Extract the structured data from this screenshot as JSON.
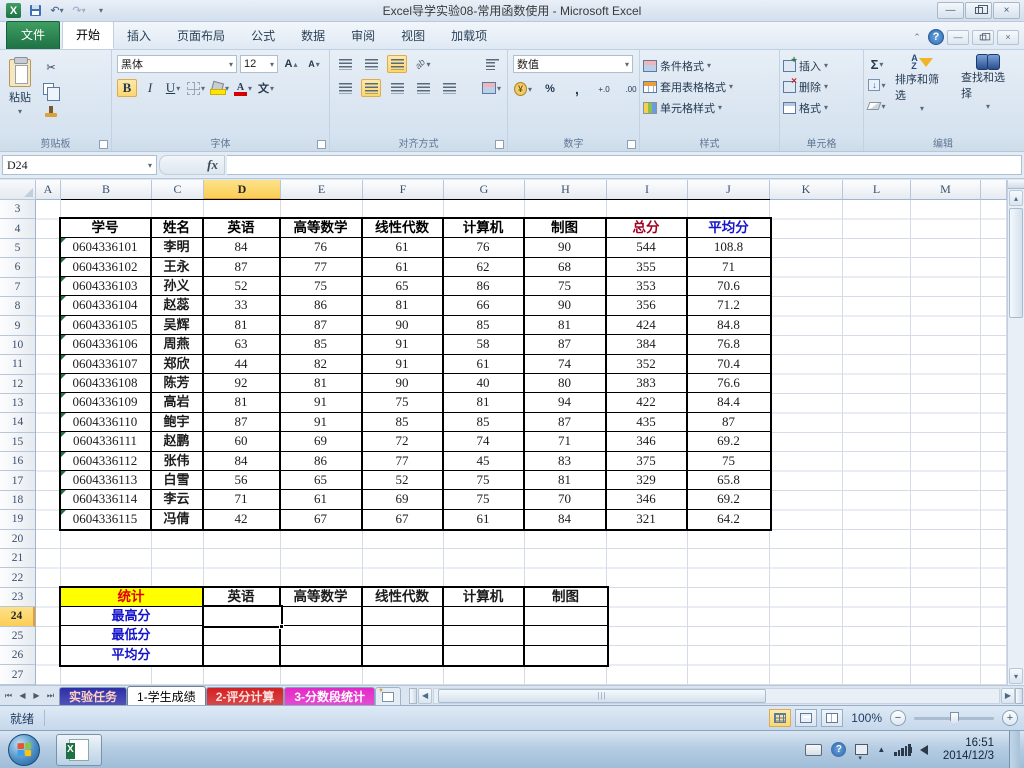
{
  "icons": {
    "dd": "▾",
    "up": "▲",
    "left": "◀",
    "right": "▶",
    "tri_up": "▴",
    "undo": "↶",
    "redo": "↷",
    "min": "—",
    "close": "×",
    "chev": "︿",
    "cut": "✂",
    "sigma": "Σ",
    "percent": "%",
    "comma": ",",
    "dec_inc": "+.0",
    "dec_dec": ".00",
    "bold": "B",
    "italic": "I",
    "underline": "U",
    "wen": "文",
    "ab": "ab",
    "yen": "¥",
    "az_a": "A",
    "az_z": "Z",
    "fill_down": "↓",
    "help": "?",
    "fx": "fx",
    "first": "⏮",
    "prev": "◀",
    "next": "▶",
    "last": "⏭",
    "grip": "|||"
  },
  "titlebar": {
    "title": "Excel导学实验08-常用函数使用 - Microsoft Excel"
  },
  "ribbon_tabs": {
    "file": "文件",
    "tabs": [
      "开始",
      "插入",
      "页面布局",
      "公式",
      "数据",
      "审阅",
      "视图",
      "加载项"
    ],
    "active": "开始"
  },
  "ribbon": {
    "clipboard": {
      "label": "剪贴板",
      "paste": "粘贴"
    },
    "font": {
      "label": "字体",
      "font_name": "黑体",
      "font_size": "12"
    },
    "alignment": {
      "label": "对齐方式"
    },
    "number": {
      "label": "数字",
      "format": "数值"
    },
    "styles": {
      "label": "样式",
      "buttons": [
        "条件格式",
        "套用表格格式",
        "单元格样式"
      ]
    },
    "cells": {
      "label": "单元格",
      "buttons": [
        "插入",
        "删除",
        "格式"
      ]
    },
    "editing": {
      "label": "编辑",
      "sort": "排序和筛选",
      "find": "查找和选择"
    }
  },
  "formula_bar": {
    "name_box": "D24",
    "value": ""
  },
  "sheet": {
    "columns": [
      "A",
      "B",
      "C",
      "D",
      "E",
      "F",
      "G",
      "H",
      "I",
      "J",
      "K",
      "L",
      "M"
    ],
    "first_row": 3,
    "visible_rows": 25,
    "selected_cell": "D24",
    "selected_col": "D",
    "selected_row": 24,
    "score_table": {
      "headers": [
        "学号",
        "姓名",
        "英语",
        "高等数学",
        "线性代数",
        "计算机",
        "制图",
        "总分",
        "平均分"
      ],
      "header_colors": [
        "#000000",
        "#000000",
        "#000000",
        "#000000",
        "#000000",
        "#000000",
        "#000000",
        "#a00021",
        "#1414cc"
      ],
      "rows": [
        [
          "0604336101",
          "李明",
          "84",
          "76",
          "61",
          "76",
          "90",
          "544",
          "108.8"
        ],
        [
          "0604336102",
          "王永",
          "87",
          "77",
          "61",
          "62",
          "68",
          "355",
          "71"
        ],
        [
          "0604336103",
          "孙义",
          "52",
          "75",
          "65",
          "86",
          "75",
          "353",
          "70.6"
        ],
        [
          "0604336104",
          "赵蕊",
          "33",
          "86",
          "81",
          "66",
          "90",
          "356",
          "71.2"
        ],
        [
          "0604336105",
          "吴辉",
          "81",
          "87",
          "90",
          "85",
          "81",
          "424",
          "84.8"
        ],
        [
          "0604336106",
          "周燕",
          "63",
          "85",
          "91",
          "58",
          "87",
          "384",
          "76.8"
        ],
        [
          "0604336107",
          "郑欣",
          "44",
          "82",
          "91",
          "61",
          "74",
          "352",
          "70.4"
        ],
        [
          "0604336108",
          "陈芳",
          "92",
          "81",
          "90",
          "40",
          "80",
          "383",
          "76.6"
        ],
        [
          "0604336109",
          "高岩",
          "81",
          "91",
          "75",
          "81",
          "94",
          "422",
          "84.4"
        ],
        [
          "0604336110",
          "鲍宇",
          "87",
          "91",
          "85",
          "85",
          "87",
          "435",
          "87"
        ],
        [
          "0604336111",
          "赵鹏",
          "60",
          "69",
          "72",
          "74",
          "71",
          "346",
          "69.2"
        ],
        [
          "0604336112",
          "张伟",
          "84",
          "86",
          "77",
          "45",
          "83",
          "375",
          "75"
        ],
        [
          "0604336113",
          "白雪",
          "56",
          "65",
          "52",
          "75",
          "81",
          "329",
          "65.8"
        ],
        [
          "0604336114",
          "李云",
          "71",
          "61",
          "69",
          "75",
          "70",
          "346",
          "69.2"
        ],
        [
          "0604336115",
          "冯倩",
          "42",
          "67",
          "67",
          "61",
          "84",
          "321",
          "64.2"
        ]
      ]
    },
    "stats_table": {
      "title": "统计",
      "headers": [
        "英语",
        "高等数学",
        "线性代数",
        "计算机",
        "制图"
      ],
      "row_labels": [
        "最高分",
        "最低分",
        "平均分"
      ]
    }
  },
  "sheet_tabs": {
    "tabs": [
      {
        "label": "实验任务",
        "color": "#2e2ea8",
        "text_color": "#ffd0c0",
        "active": false
      },
      {
        "label": "1-学生成绩",
        "color": "",
        "text_color": "#000000",
        "active": true
      },
      {
        "label": "2-评分计算",
        "color": "#d42020",
        "text_color": "#ffe0e0",
        "active": false
      },
      {
        "label": "3-分数段统计",
        "color": "#e428c8",
        "text_color": "#ffffff",
        "active": false
      }
    ]
  },
  "status_bar": {
    "status": "就绪",
    "zoom": "100%"
  },
  "taskbar": {
    "time": "16:51",
    "date": "2014/12/3"
  }
}
